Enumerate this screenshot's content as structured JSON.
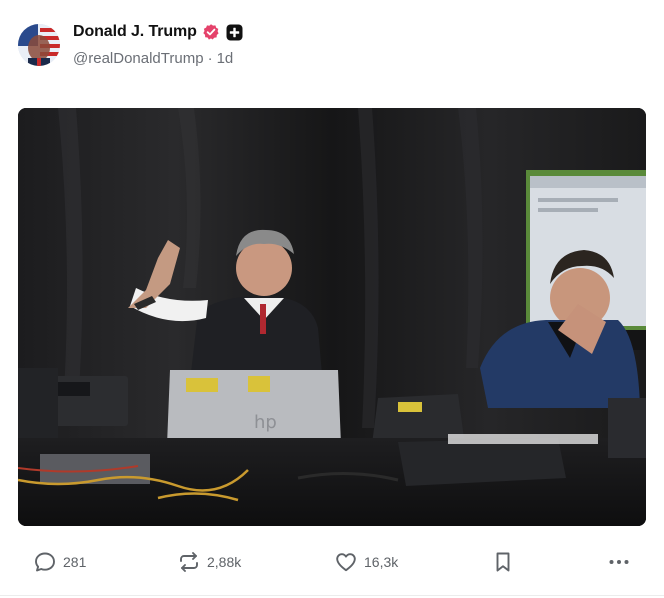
{
  "post": {
    "author": {
      "display_name": "Donald J. Trump",
      "handle": "@realDonaldTrump",
      "age": "1d",
      "separator": "·",
      "verified_icon": "verified-badge-icon",
      "badge_icon": "plus-badge-icon"
    },
    "media": {
      "type": "photo"
    },
    "actions": {
      "reply_count": "281",
      "repost_count": "2,88k",
      "like_count": "16,3k"
    }
  },
  "colors": {
    "verified": "#e5426b",
    "text_primary": "#111111",
    "text_secondary": "#6b6f76",
    "icon": "#5f6368"
  }
}
